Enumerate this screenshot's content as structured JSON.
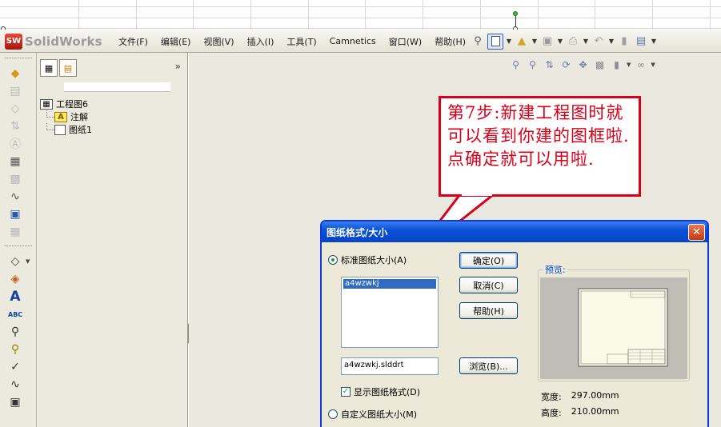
{
  "app": {
    "logo_badge": "SW",
    "logo_text": "SolidWorks"
  },
  "menubar": {
    "items": [
      "文件(F)",
      "编辑(E)",
      "视图(V)",
      "插入(I)",
      "工具(T)",
      "Camnetics",
      "窗口(W)",
      "帮助(H)"
    ]
  },
  "feature_tree": {
    "root": "工程图6",
    "children": [
      "注解",
      "图纸1"
    ],
    "annotation_icon_letter": "A"
  },
  "callout": {
    "text": "第7步:新建工程图时就可以看到你建的图框啦.点确定就可以用啦.",
    "color": "#d9001a"
  },
  "dialog": {
    "title": "图纸格式/大小",
    "standard_radio": "标准图纸大小(A)",
    "standard_selected": true,
    "list_items": [
      "a4wzwkj"
    ],
    "format_file": "a4wzwkj.slddrt",
    "show_format_checkbox": "显示图纸格式(D)",
    "show_format_checked": true,
    "custom_radio": "自定义图纸大小(M)",
    "custom_selected": false,
    "buttons": {
      "ok": "确定(O)",
      "cancel": "取消(C)",
      "help": "帮助(H)",
      "browse": "浏览(B)..."
    },
    "preview_label": "预览:",
    "width_label": "宽度:",
    "width_value": "297.00mm",
    "height_label": "高度:",
    "height_value": "210.00mm",
    "close_glyph": "✕"
  }
}
